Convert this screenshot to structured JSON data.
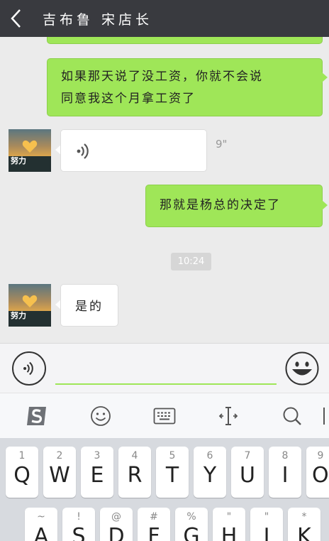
{
  "header": {
    "back_icon": "chevron-left-icon",
    "title": "吉布鲁 宋店长"
  },
  "messages": [
    {
      "side": "right",
      "type": "text",
      "text_line1": "如果那天说了没工资，你就不会说",
      "text_line2": "同意我这个月拿工资了"
    },
    {
      "side": "left",
      "type": "voice",
      "avatar_text": "努力",
      "duration": "9\""
    },
    {
      "side": "right",
      "type": "text",
      "text": "那就是杨总的决定了"
    },
    {
      "side": "center",
      "type": "time",
      "text": "10:24"
    },
    {
      "side": "left",
      "type": "text",
      "avatar_text": "努力",
      "text": "是的"
    }
  ],
  "input": {
    "value": "",
    "placeholder": "",
    "voice_icon": "voice-icon",
    "emoji_icon": "emoji-icon"
  },
  "ime_toolbar": {
    "items": [
      "sogou-logo-icon",
      "smiley-icon",
      "keyboard-icon",
      "cursor-move-icon",
      "search-icon"
    ]
  },
  "keyboard": {
    "row1": [
      {
        "num": "1",
        "letter": "Q"
      },
      {
        "num": "2",
        "letter": "W"
      },
      {
        "num": "3",
        "letter": "E"
      },
      {
        "num": "4",
        "letter": "R"
      },
      {
        "num": "5",
        "letter": "T"
      },
      {
        "num": "6",
        "letter": "Y"
      },
      {
        "num": "7",
        "letter": "U"
      },
      {
        "num": "8",
        "letter": "I"
      },
      {
        "num": "9",
        "letter": "O"
      }
    ],
    "row2": [
      {
        "num": "~",
        "letter": "A"
      },
      {
        "num": "!",
        "letter": "S"
      },
      {
        "num": "@",
        "letter": "D"
      },
      {
        "num": "#",
        "letter": "F"
      },
      {
        "num": "%",
        "letter": "G"
      },
      {
        "num": "\"",
        "letter": "H"
      },
      {
        "num": "\"",
        "letter": "J"
      },
      {
        "num": "*",
        "letter": "K"
      }
    ]
  },
  "colors": {
    "header_bg": "#393a3f",
    "bubble_green": "#9fe658",
    "chat_bg": "#ebebeb",
    "keyboard_bg": "#d7dadf"
  }
}
